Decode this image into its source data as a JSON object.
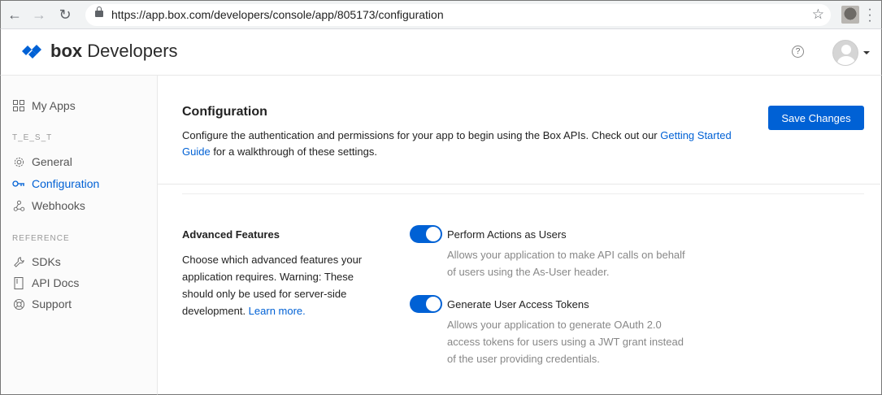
{
  "browser": {
    "url": "https://app.box.com/developers/console/app/805173/configuration"
  },
  "header": {
    "brand_box": "box",
    "brand_rest": " Developers",
    "help_symbol": "?"
  },
  "sidebar": {
    "my_apps": "My Apps",
    "app_heading": "T_E_S_T",
    "app_items": [
      "General",
      "Configuration",
      "Webhooks"
    ],
    "reference_heading": "REFERENCE",
    "reference_items": [
      "SDKs",
      "API Docs",
      "Support"
    ]
  },
  "main": {
    "title": "Configuration",
    "description_pre": "Configure the authentication and permissions for your app to begin using the Box APIs. Check out our ",
    "description_link": "Getting Started Guide",
    "description_post": " for a walkthrough of these settings.",
    "save_label": "Save Changes",
    "advanced": {
      "title": "Advanced Features",
      "description": "Choose which advanced features your application requires. Warning: These should only be used for server-side development. ",
      "learn_more": "Learn more.",
      "options": [
        {
          "title": "Perform Actions as Users",
          "description": "Allows your application to make API calls on behalf of users using the As-User header.",
          "enabled": true
        },
        {
          "title": "Generate User Access Tokens",
          "description": "Allows your application to generate OAuth 2.0 access tokens for users using a JWT grant instead of the user providing credentials.",
          "enabled": true
        }
      ]
    }
  },
  "colors": {
    "accent": "#0061d5"
  }
}
